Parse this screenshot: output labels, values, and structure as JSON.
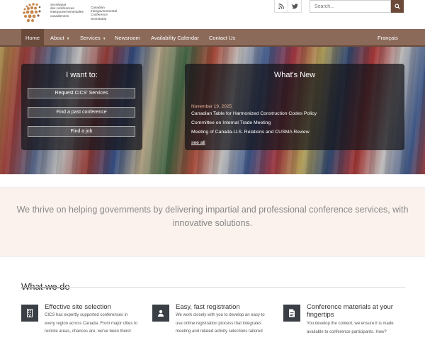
{
  "header": {
    "logo_fr": [
      "Secrétariat",
      "des conférences",
      "intergouvernementales",
      "canadiennes"
    ],
    "logo_en": [
      "Canadian",
      "Intergovernmental",
      "Conference",
      "Secretariat"
    ],
    "search_placeholder": "Search...",
    "icons": [
      "rss-icon",
      "twitter-icon",
      "search-icon"
    ]
  },
  "nav": {
    "items": [
      {
        "label": "Home",
        "active": true,
        "dropdown": false
      },
      {
        "label": "About",
        "active": false,
        "dropdown": true
      },
      {
        "label": "Services",
        "active": false,
        "dropdown": true
      },
      {
        "label": "Newsroom",
        "active": false,
        "dropdown": false
      },
      {
        "label": "Availability Calendar",
        "active": false,
        "dropdown": false
      },
      {
        "label": "Contact Us",
        "active": false,
        "dropdown": false
      }
    ],
    "language": "Français"
  },
  "hero": {
    "want": {
      "title": "I want to:",
      "buttons": [
        "Request CICS' Services",
        "Find a past conference",
        "Find a job"
      ]
    },
    "news": {
      "title": "What's New",
      "date": "November 19, 2025",
      "items": [
        "Canadian Table for Harmonized Construction Codes Policy",
        "Committee on Internal Trade Meeting",
        "Meeting of Canada-U.S. Relations and CUSMA Review"
      ],
      "see_all": "see all"
    }
  },
  "tagline": "We thrive on helping governments by delivering impartial and professional conference services, with innovative solutions.",
  "what_we_do": {
    "title": "What we do",
    "features": [
      {
        "icon": "building-icon",
        "title": "Effective site selection",
        "lines": [
          "CICS has expertly supported conferences in",
          "every region across Canada. From major cities to",
          "remote areas, chances are, we've been there!"
        ]
      },
      {
        "icon": "user-icon",
        "title": "Easy, fast registration",
        "lines": [
          "We work closely with you to develop an easy to",
          "use online registration process that integrates",
          "meeting and related activity selections tailored"
        ]
      },
      {
        "icon": "document-icon",
        "title": "Conference materials at your fingertips",
        "lines": [
          "You develop the content, we ensure it is made",
          "available to conference participants. How?"
        ]
      }
    ]
  },
  "colors": {
    "nav_bg": "#8c6a59",
    "nav_active": "#6a4a3b",
    "accent_date": "#e6b59b",
    "tagline_bg": "#fbf2ed",
    "icon_bg": "#3a3f45"
  }
}
